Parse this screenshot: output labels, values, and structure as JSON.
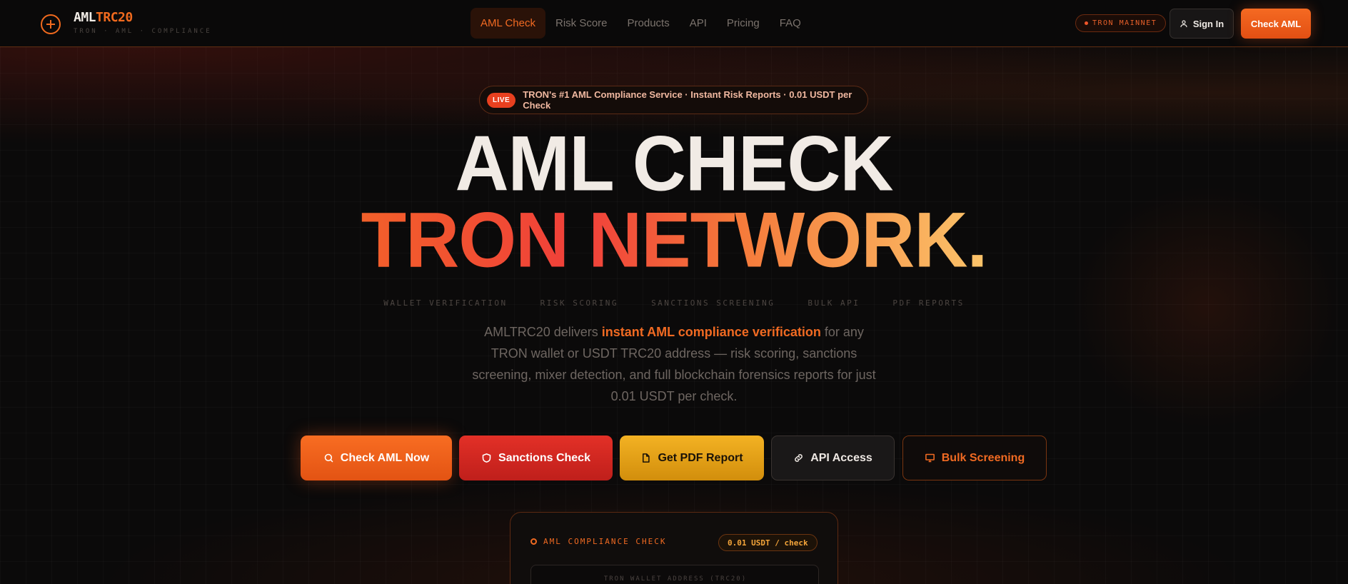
{
  "header": {
    "logo_part1": "AML",
    "logo_part2": "TRC20",
    "logo_sub": "TRON · AML · COMPLIANCE",
    "nav": [
      "AML Check",
      "Risk Score",
      "Products",
      "API",
      "Pricing",
      "FAQ"
    ],
    "network_badge": "TRON MAINNET",
    "sign_in": "Sign In",
    "check_aml": "Check AML"
  },
  "hero": {
    "live_tag": "LIVE",
    "live_text": "TRON's #1 AML Compliance Service · Instant Risk Reports · 0.01 USDT per Check",
    "title_line1": "AML CHECK",
    "title_line2": "TRON NETWORK.",
    "features": [
      "WALLET VERIFICATION",
      "RISK SCORING",
      "SANCTIONS SCREENING",
      "BULK API",
      "PDF REPORTS"
    ],
    "desc_pre": "AMLTRC20 delivers ",
    "desc_highlight": "instant AML compliance verification",
    "desc_post": " for any TRON wallet or USDT TRC20 address — risk scoring, sanctions screening, mixer detection, and full blockchain forensics reports for just 0.01 USDT per check."
  },
  "cta": {
    "check_now": "Check AML Now",
    "sanctions": "Sanctions Check",
    "pdf": "Get PDF Report",
    "api": "API Access",
    "bulk": "Bulk Screening"
  },
  "card": {
    "title": "AML COMPLIANCE CHECK",
    "price": "0.01 USDT / check",
    "address_label": "TRON WALLET ADDRESS (TRC20)"
  },
  "colors": {
    "accent": "#f06a22",
    "background": "#0b0a0a",
    "danger": "#e33027",
    "gold": "#f3b223"
  },
  "icons": {
    "logo": "crosshair-icon",
    "sign_in": "user-icon",
    "check_now": "search-icon",
    "sanctions": "shield-icon",
    "pdf": "file-icon",
    "api": "link-icon",
    "bulk": "monitor-icon"
  }
}
